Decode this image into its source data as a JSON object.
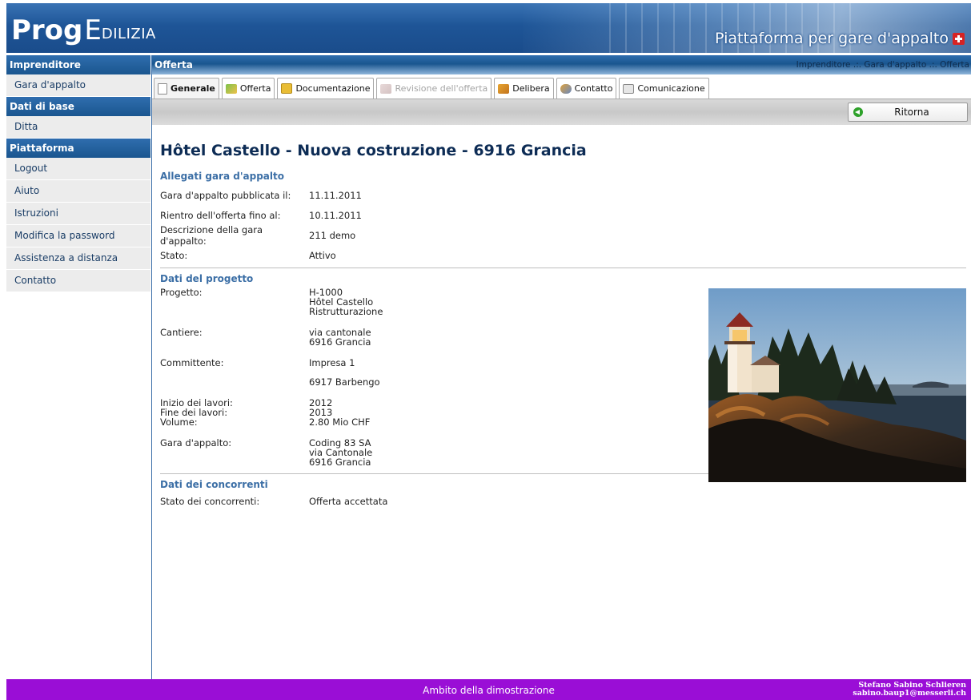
{
  "header": {
    "logo_bold": "Prog",
    "logo_big_letter": "E",
    "logo_rest": "DILIZIA",
    "tagline": "Piattaforma per gare d'appalto"
  },
  "sidebar": {
    "sections": [
      {
        "title": "Imprenditore",
        "items": [
          "Gara d'appalto"
        ]
      },
      {
        "title": "Dati di base",
        "items": [
          "Ditta"
        ]
      },
      {
        "title": "Piattaforma",
        "items": [
          "Logout",
          "Aiuto",
          "Istruzioni",
          "Modifica la password",
          "Assistenza a distanza",
          "Contatto"
        ]
      }
    ]
  },
  "main": {
    "title": "Offerta",
    "breadcrumb": "Imprenditore .:. Gara d'appalto .:. Offerta",
    "tabs": [
      {
        "label": "Generale",
        "icon": "document-icon",
        "state": "active"
      },
      {
        "label": "Offerta",
        "icon": "offer-icon",
        "state": "normal"
      },
      {
        "label": "Documentazione",
        "icon": "folder-icon",
        "state": "normal"
      },
      {
        "label": "Revisione dell'offerta",
        "icon": "revision-icon",
        "state": "disabled"
      },
      {
        "label": "Delibera",
        "icon": "resolution-icon",
        "state": "normal"
      },
      {
        "label": "Contatto",
        "icon": "contacts-icon",
        "state": "normal"
      },
      {
        "label": "Comunicazione",
        "icon": "message-icon",
        "state": "normal"
      }
    ],
    "return_button": "Ritorna",
    "page_title": "Hôtel Castello - Nuova costruzione - 6916 Grancia",
    "attachments": {
      "heading": "Allegati gara d'appalto",
      "rows": [
        {
          "label": "Gara d'appalto pubblicata il:",
          "value": "11.11.2011"
        },
        {
          "label": "Rientro dell'offerta fino al:",
          "value": "10.11.2011"
        },
        {
          "label": "Descrizione della gara d'appalto:",
          "value": "211 demo"
        },
        {
          "label": "Stato:",
          "value": "Attivo"
        }
      ]
    },
    "project": {
      "heading": "Dati del progetto",
      "progetto_label": "Progetto:",
      "progetto_lines": [
        "H-1000",
        "Hôtel Castello",
        "Ristrutturazione"
      ],
      "cantiere_label": "Cantiere:",
      "cantiere_lines": [
        "via cantonale",
        "6916 Grancia"
      ],
      "committente_label": "Committente:",
      "committente_lines": [
        "Impresa 1",
        "6917 Barbengo"
      ],
      "inizio_label": "Inizio dei lavori:",
      "inizio_value": "2012",
      "fine_label": "Fine dei lavori:",
      "fine_value": "2013",
      "volume_label": "Volume:",
      "volume_value": "2.80 Mio CHF",
      "gara_label": "Gara d'appalto:",
      "gara_lines": [
        "Coding 83 SA",
        "via Cantonale",
        "6916 Grancia"
      ]
    },
    "competitors": {
      "heading": "Dati dei concorrenti",
      "label": "Stato dei concorrenti:",
      "value": "Offerta accettata"
    }
  },
  "footer": {
    "center": "Ambito della dimostrazione",
    "user_name": "Stefano Sabino  Schlieren",
    "user_email": "sabino.baup1@messerli.ch"
  },
  "colors": {
    "header_blue": "#1e5597",
    "footer_purple": "#9a0ed6",
    "title_navy": "#0d2c55",
    "section_blue": "#3c6fa6"
  }
}
